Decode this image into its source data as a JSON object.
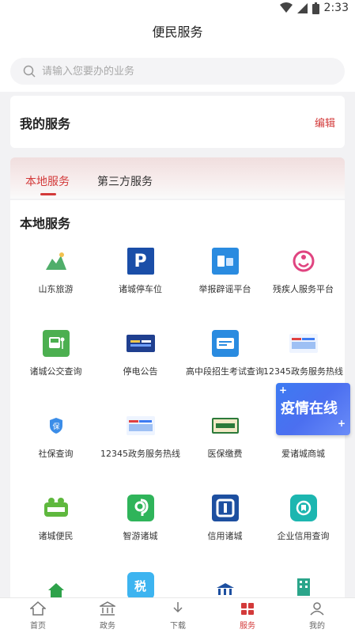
{
  "status_bar": {
    "time": "2:33"
  },
  "header": {
    "title": "便民服务"
  },
  "search": {
    "placeholder": "请输入您要办的业务"
  },
  "my_services": {
    "title": "我的服务",
    "edit_label": "编辑"
  },
  "tabs": [
    {
      "label": "本地服务",
      "active": true
    },
    {
      "label": "第三方服务",
      "active": false
    }
  ],
  "local": {
    "section_title": "本地服务",
    "items": [
      {
        "label": "山东旅游",
        "icon": "mountain-icon"
      },
      {
        "label": "诸城停车位",
        "icon": "parking-icon"
      },
      {
        "label": "举报辟谣平台",
        "icon": "report-icon"
      },
      {
        "label": "残疾人服务平台",
        "icon": "disability-icon"
      },
      {
        "label": "诸城公交查询",
        "icon": "bus-icon"
      },
      {
        "label": "停电公告",
        "icon": "power-notice-icon"
      },
      {
        "label": "高中段招生考试查询",
        "icon": "exam-query-icon"
      },
      {
        "label": "12345政务服务热线",
        "icon": "hotline-icon"
      },
      {
        "label": "社保查询",
        "icon": "social-security-icon"
      },
      {
        "label": "12345政务服务热线",
        "icon": "hotline-icon"
      },
      {
        "label": "医保缴费",
        "icon": "medical-insurance-icon"
      },
      {
        "label": "爱诸城商城",
        "icon": "mall-icon"
      },
      {
        "label": "诸城便民",
        "icon": "convenience-icon"
      },
      {
        "label": "智游诸城",
        "icon": "smart-travel-icon"
      },
      {
        "label": "信用诸城",
        "icon": "credit-icon"
      },
      {
        "label": "企业信用查询",
        "icon": "enterprise-credit-icon"
      },
      {
        "label": "",
        "icon": "house-icon"
      },
      {
        "label": "",
        "icon": "tax-icon"
      },
      {
        "label": "",
        "icon": "bank-icon"
      },
      {
        "label": "",
        "icon": "building-icon"
      }
    ]
  },
  "promo": {
    "text": "疫情在线"
  },
  "bottom_nav": [
    {
      "label": "首页",
      "icon": "home-icon",
      "active": false
    },
    {
      "label": "政务",
      "icon": "government-icon",
      "active": false
    },
    {
      "label": "下载",
      "icon": "download-icon",
      "active": false
    },
    {
      "label": "服务",
      "icon": "service-icon",
      "active": true
    },
    {
      "label": "我的",
      "icon": "user-icon",
      "active": false
    }
  ],
  "colors": {
    "accent": "#d33a3a",
    "promo_blue": "#3d7bf2"
  }
}
